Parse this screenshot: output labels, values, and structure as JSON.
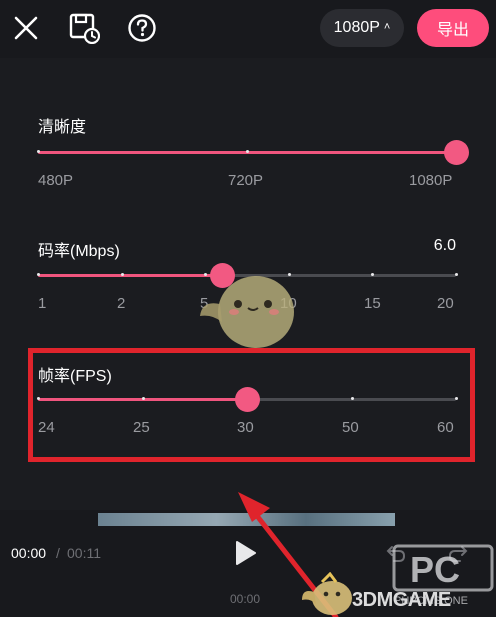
{
  "topbar": {
    "resolution_label": "1080P",
    "export_label": "导出"
  },
  "resolution": {
    "title": "清晰度",
    "ticks": [
      "480P",
      "720P",
      "1080P"
    ],
    "value_fraction": 1.0
  },
  "bitrate": {
    "title": "码率(Mbps)",
    "value": "6.0",
    "ticks": [
      "1",
      "2",
      "5",
      "10",
      "15",
      "20"
    ],
    "value_fraction": 0.44
  },
  "framerate": {
    "title": "帧率(FPS)",
    "ticks": [
      "24",
      "25",
      "30",
      "50",
      "60"
    ],
    "value_fraction": 0.5
  },
  "player": {
    "current_time": "00:00",
    "separator": "/",
    "total_time": "00:11",
    "timeline_label": "00:00"
  },
  "watermark": {
    "site": "3DMGAME",
    "logo_letters": "PC",
    "logo_caption": "PHPCMS.ONE"
  },
  "colors": {
    "accent": "#fe4d7c",
    "slider_fill": "#f0557e",
    "highlight_border": "#e0242c",
    "background": "#18191d"
  },
  "icons": [
    "close-icon",
    "save-draft-icon",
    "help-icon",
    "chevron-up-icon",
    "play-icon",
    "undo-icon",
    "redo-icon"
  ]
}
